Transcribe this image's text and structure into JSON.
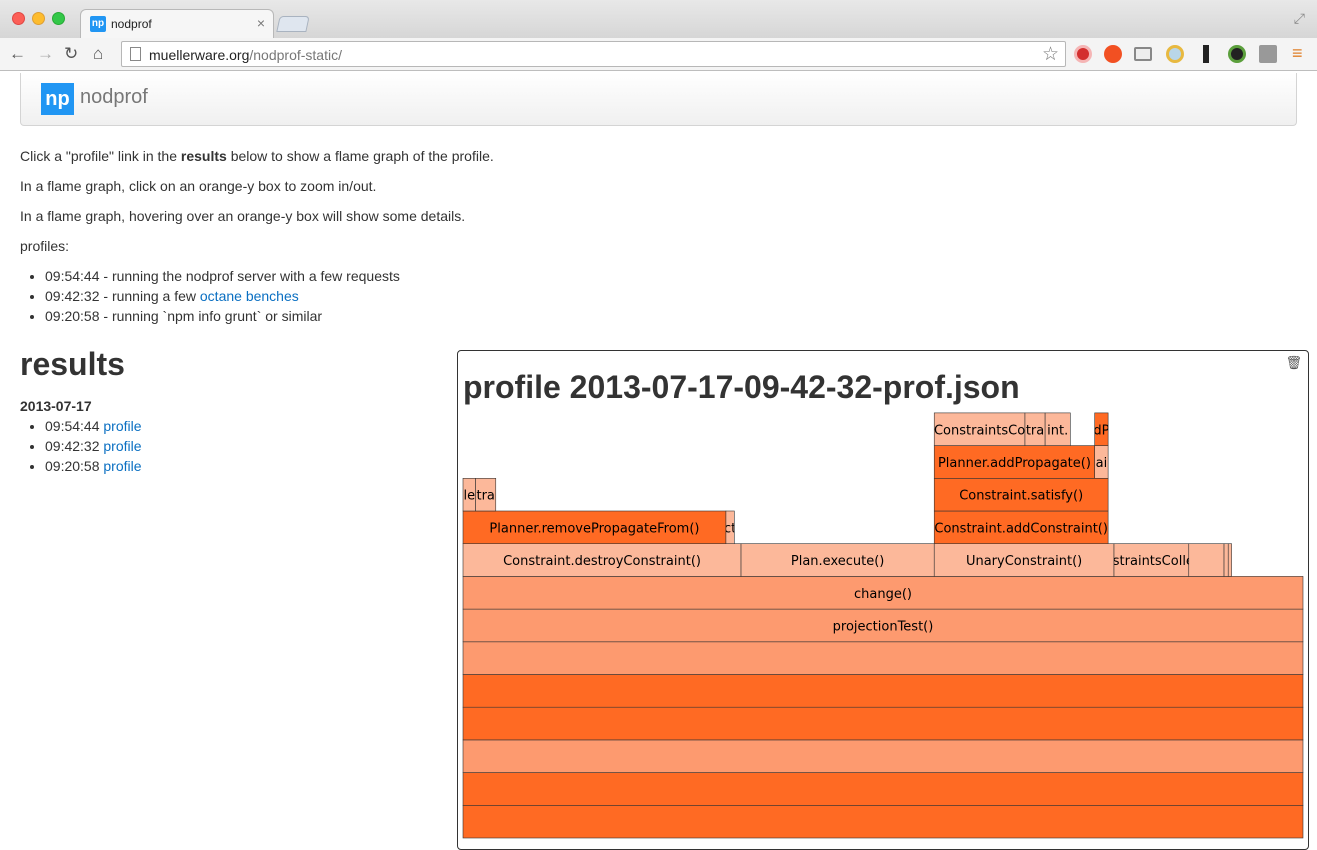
{
  "browser": {
    "tab_title": "nodprof",
    "tab_favicon": "np",
    "url_domain": "muellerware.org",
    "url_path": "/nodprof-static/"
  },
  "navbar": {
    "logo": "np",
    "brand": "nodprof"
  },
  "intro": {
    "line1_pre": "Click a \"profile\" link in the ",
    "line1_bold": "results",
    "line1_post": " below to show a flame graph of the profile.",
    "line2": "In a flame graph, click on an orange-y box to zoom in/out.",
    "line3": "In a flame graph, hovering over an orange-y box will show some details.",
    "profiles_label": "profiles:"
  },
  "profiles": [
    {
      "text": "09:54:44 - running the nodprof server with a few requests",
      "link": ""
    },
    {
      "text": "09:42:32 - running a few ",
      "link": "octane benches"
    },
    {
      "text": "09:20:58 - running `npm info grunt` or similar",
      "link": ""
    }
  ],
  "results": {
    "heading": "results",
    "date": "2013-07-17",
    "items": [
      {
        "time": "09:54:44 ",
        "link": "profile"
      },
      {
        "time": "09:42:32 ",
        "link": "profile"
      },
      {
        "time": "09:20:58 ",
        "link": "profile"
      }
    ]
  },
  "panel": {
    "title": "profile 2013-07-17-09-42-32-prof.json"
  },
  "colors": {
    "dark": "#ff6a23",
    "medium": "#fd9a6f",
    "light": "#fcb89a",
    "link": "#0a6fc2"
  },
  "flame": [
    {
      "label": "",
      "color": "dark",
      "level": 0,
      "start": 0,
      "end": 1
    },
    {
      "label": "",
      "color": "dark",
      "level": 1,
      "start": 0,
      "end": 1
    },
    {
      "label": "",
      "color": "medium",
      "level": 2,
      "start": 0,
      "end": 1
    },
    {
      "label": "",
      "color": "dark",
      "level": 3,
      "start": 0,
      "end": 1
    },
    {
      "label": "",
      "color": "dark",
      "level": 4,
      "start": 0,
      "end": 1
    },
    {
      "label": "",
      "color": "medium",
      "level": 5,
      "start": 0,
      "end": 1
    },
    {
      "label": "projectionTest()",
      "color": "medium",
      "level": 6,
      "start": 0,
      "end": 1
    },
    {
      "label": "change()",
      "color": "medium",
      "level": 7,
      "start": 0,
      "end": 1
    },
    {
      "label": "Constraint.destroyConstraint()",
      "color": "light",
      "level": 8,
      "start": 0,
      "end": 0.331
    },
    {
      "label": "Plan.execute()",
      "color": "light",
      "level": 8,
      "start": 0.331,
      "end": 0.561
    },
    {
      "label": "UnaryConstraint()",
      "color": "light",
      "level": 8,
      "start": 0.561,
      "end": 0.775
    },
    {
      "label": "onstraintsCollect",
      "color": "light",
      "level": 8,
      "start": 0.775,
      "end": 0.864
    },
    {
      "label": "",
      "color": "light",
      "level": 8,
      "start": 0.864,
      "end": 0.906
    },
    {
      "label": "",
      "color": "light",
      "level": 8,
      "start": 0.906,
      "end": 0.911
    },
    {
      "label": "",
      "color": "light",
      "level": 8,
      "start": 0.911,
      "end": 0.915
    },
    {
      "label": "Planner.removePropagateFrom()",
      "color": "dark",
      "level": 9,
      "start": 0,
      "end": 0.313
    },
    {
      "label": "ct",
      "color": "light",
      "level": 9,
      "start": 0.313,
      "end": 0.323
    },
    {
      "label": "Constraint.addConstraint()",
      "color": "dark",
      "level": 9,
      "start": 0.561,
      "end": 0.768
    },
    {
      "label": "le",
      "color": "light",
      "level": 10,
      "start": 0,
      "end": 0.015
    },
    {
      "label": "tra",
      "color": "light",
      "level": 10,
      "start": 0.015,
      "end": 0.039
    },
    {
      "label": "Constraint.satisfy()",
      "color": "dark",
      "level": 10,
      "start": 0.561,
      "end": 0.768
    },
    {
      "label": "Planner.addPropagate()",
      "color": "dark",
      "level": 11,
      "start": 0.561,
      "end": 0.752
    },
    {
      "label": "ai",
      "color": "light",
      "level": 11,
      "start": 0.752,
      "end": 0.768
    },
    {
      "label": "ConstraintsCo",
      "color": "light",
      "level": 12,
      "start": 0.561,
      "end": 0.669
    },
    {
      "label": "tra",
      "color": "light",
      "level": 12,
      "start": 0.669,
      "end": 0.693
    },
    {
      "label": "int.",
      "color": "light",
      "level": 12,
      "start": 0.693,
      "end": 0.723
    },
    {
      "label": "dP",
      "color": "dark",
      "level": 12,
      "start": 0.752,
      "end": 0.768
    }
  ]
}
